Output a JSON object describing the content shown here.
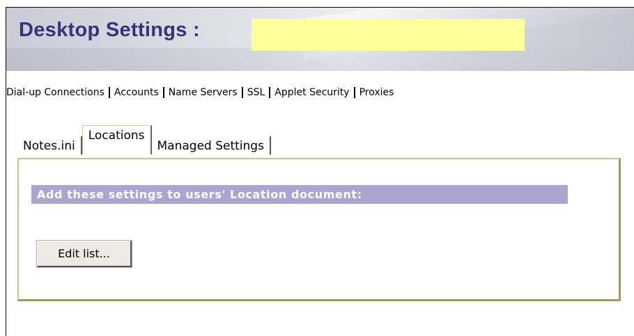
{
  "header": {
    "title": "Desktop Settings :"
  },
  "top_tabs": [
    {
      "label": "Dial-up Connections"
    },
    {
      "label": "Accounts"
    },
    {
      "label": "Name Servers"
    },
    {
      "label": "SSL"
    },
    {
      "label": "Applet Security"
    },
    {
      "label": "Proxies"
    }
  ],
  "sub_tabs": [
    {
      "label": "Notes.ini"
    },
    {
      "label": "Locations"
    },
    {
      "label": "Managed Settings"
    }
  ],
  "panel": {
    "heading": "Add these settings to users' Location document:",
    "edit_button": "Edit list..."
  },
  "colors": {
    "title": "#34347a",
    "redaction": "#ffff99",
    "heading_bg": "#aaa6cf",
    "panel_border": "#c8c48e"
  }
}
